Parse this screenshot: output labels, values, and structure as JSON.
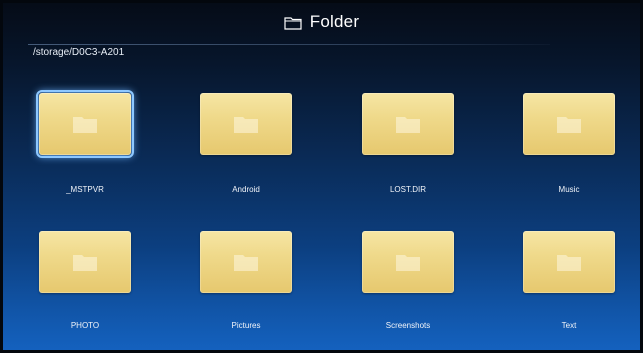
{
  "header": {
    "title": "Folder",
    "icon": "folder-outline-icon"
  },
  "path": "/storage/D0C3-A201",
  "folders": [
    {
      "label": "_MSTPVR",
      "icon": "folder-icon",
      "focused": true
    },
    {
      "label": "Android",
      "icon": "folder-icon",
      "focused": false
    },
    {
      "label": "LOST.DIR",
      "icon": "folder-icon",
      "focused": false
    },
    {
      "label": "Music",
      "icon": "folder-icon",
      "focused": false
    },
    {
      "label": "PHOTO",
      "icon": "folder-icon",
      "focused": false
    },
    {
      "label": "Pictures",
      "icon": "folder-icon",
      "focused": false
    },
    {
      "label": "Screenshots",
      "icon": "folder-icon",
      "focused": false
    },
    {
      "label": "Text",
      "icon": "folder-icon",
      "focused": false
    }
  ],
  "colors": {
    "thumb": "#efd98a",
    "focus": "#8ec8ff",
    "text": "#ffffff"
  }
}
